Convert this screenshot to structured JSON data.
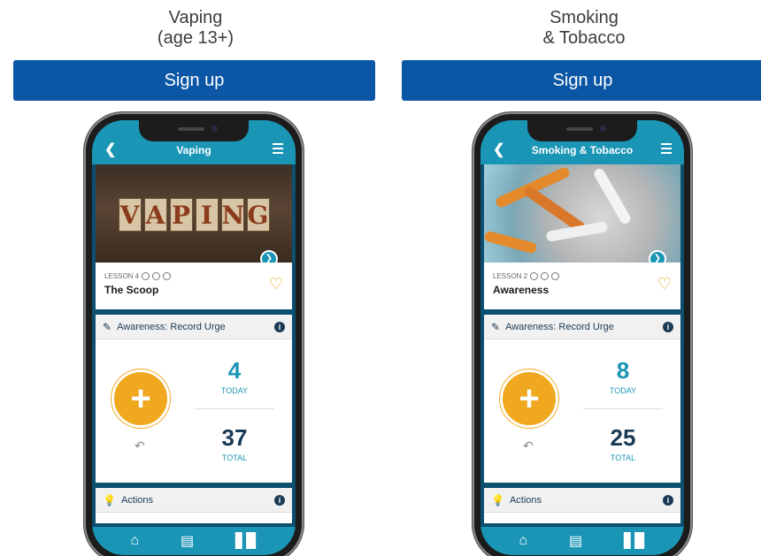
{
  "columns": [
    {
      "title_line1": "Vaping",
      "title_line2": "(age 13+)",
      "signup_label": "Sign up",
      "app": {
        "header_title": "Vaping",
        "lesson_label": "LESSON 4",
        "lesson_title": "The Scoop",
        "image_word": [
          "V",
          "A",
          "P",
          "I",
          "N",
          "G"
        ],
        "urge_header": "Awareness: Record Urge",
        "today_count": "4",
        "today_label": "TODAY",
        "total_count": "37",
        "total_label": "TOTAL",
        "actions_header": "Actions"
      }
    },
    {
      "title_line1": "Smoking",
      "title_line2": "& Tobacco",
      "signup_label": "Sign up",
      "app": {
        "header_title": "Smoking & Tobacco",
        "lesson_label": "LESSON 2",
        "lesson_title": "Awareness",
        "urge_header": "Awareness: Record Urge",
        "today_count": "8",
        "today_label": "TODAY",
        "total_count": "25",
        "total_label": "TOTAL",
        "actions_header": "Actions"
      }
    }
  ],
  "icons": {
    "back": "chevron-left-icon",
    "menu": "hamburger-menu-icon",
    "play": "chevron-right-icon",
    "favorite": "heart-icon",
    "edit": "edit-icon",
    "info": "info-icon",
    "add": "plus-icon",
    "undo": "undo-icon",
    "idea": "lightbulb-icon",
    "home": "home-icon",
    "book": "book-icon",
    "stats": "bar-chart-icon"
  },
  "colors": {
    "signup_button": "#0b57a5",
    "app_teal": "#1a95b5",
    "app_navy": "#1a3a55",
    "urge_orange": "#f0a91f",
    "heart": "#e8a21a"
  }
}
